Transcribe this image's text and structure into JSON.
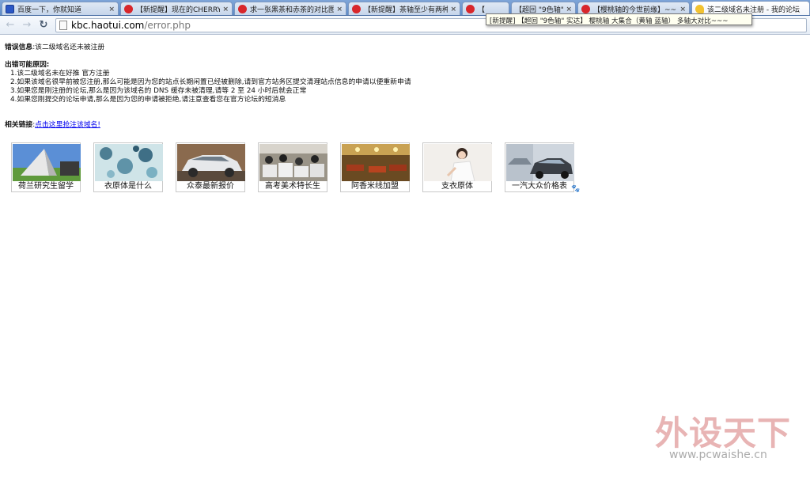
{
  "browser": {
    "tabs": [
      {
        "title": "百度一下，你就知道",
        "favicon": "baidu-icon",
        "active": false
      },
      {
        "title": "【新提醒】现在的CHERRY",
        "favicon": "forum-icon",
        "active": false
      },
      {
        "title": "求一张黑茶和赤茶的对比图",
        "favicon": "forum-icon",
        "active": false
      },
      {
        "title": "【新提醒】茶轴至少有两种",
        "favicon": "forum-icon",
        "active": false
      },
      {
        "title": "【",
        "favicon": "forum-icon",
        "active": false
      },
      {
        "title": "【超回 \"9色轴\"",
        "favicon": "forum-icon",
        "active": false
      },
      {
        "title": "【樱桃轴的今世前缘】~~",
        "favicon": "forum-icon",
        "active": false
      },
      {
        "title": "该二级域名未注册 - 我的论坛",
        "favicon": "warning-icon",
        "active": true
      }
    ],
    "tab_close_glyph": "×",
    "url_host": "kbc.haotui.com",
    "url_path": "/error.php",
    "tooltip": "[新提醒] 【超回 \"9色轴\" 实达】 樱桃轴 大集合（黄轴 蓝轴） 多轴大对比~~~",
    "back_glyph": "←",
    "forward_glyph": "→",
    "reload_glyph": "↻"
  },
  "page": {
    "error_label": "错误信息",
    "error_message": ":该二级域名还未被注册",
    "reasons_title": "出错可能原因:",
    "reasons": [
      "1.该二级域名未在好推 官方注册",
      "2.如果该域名很早前被您注册,那么可能是因为您的站点长期闲置已经被删除,请到官方站务区提交清理站点信息的申请以便重新申请",
      "3.如果您是刚注册的论坛,那么是因为该域名的 DNS 缓存未被清理,请等 2 至 24 小时后就会正常",
      "4.如果您刚提交的论坛申请,那么是因为您的申请被拒绝,请注意查看您在官方论坛的短消息"
    ],
    "related_label": "相关链接",
    "related_colon": ":",
    "related_link": "点击这里抢注该域名!",
    "cards": [
      {
        "label": "荷兰研究生留学",
        "image": "building-photo"
      },
      {
        "label": "衣原体是什么",
        "image": "microscope-photo"
      },
      {
        "label": "众泰最新报价",
        "image": "white-car-photo"
      },
      {
        "label": "高考美术特长生",
        "image": "classroom-photo"
      },
      {
        "label": "阿香米线加盟",
        "image": "restaurant-photo"
      },
      {
        "label": "支衣原体",
        "image": "woman-photo"
      },
      {
        "label": "一汽大众价格表",
        "image": "dark-car-photo"
      }
    ],
    "paw_glyph": "🐾"
  },
  "watermark": {
    "logo_text": "外设天下",
    "url": "www.pcwaishe.cn"
  }
}
